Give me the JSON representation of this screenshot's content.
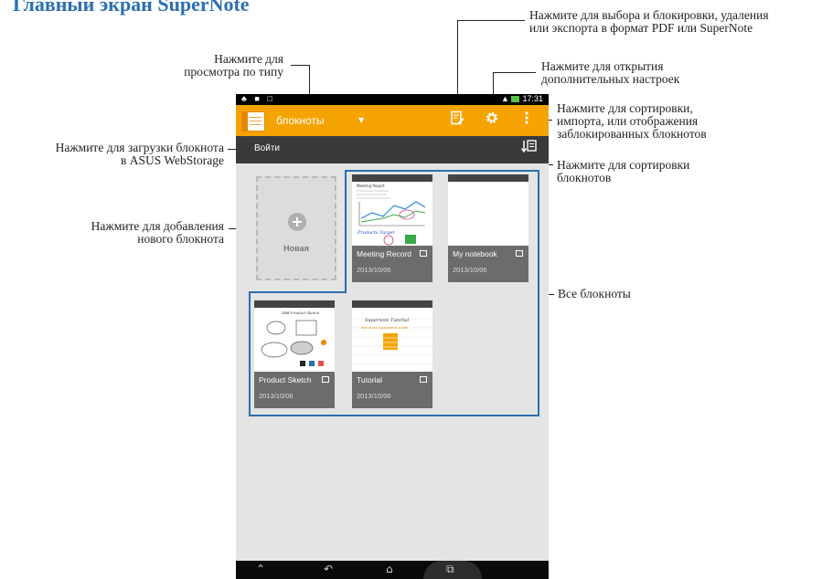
{
  "heading": "Главный экран SuperNote",
  "callouts": {
    "view_by_type": [
      "Нажмите для",
      "просмотра по типу"
    ],
    "select_lock_export": [
      "Нажмите для выбора и блокировки, удаления",
      "или экспорта в формат PDF или SuperNote"
    ],
    "settings": [
      "Нажмите для открытия",
      "дополнительных настроек"
    ],
    "sort_import_locked": [
      "Нажмите для сортировки,",
      "импорта, или отображения",
      "заблокированных блокнотов"
    ],
    "upload": [
      "Нажмите для загрузки блокнота",
      "в ASUS WebStorage"
    ],
    "sort_notebooks": [
      "Нажмите для сортировки",
      "блокнотов"
    ],
    "add_notebook": [
      "Нажмите для добавления",
      "нового блокнота"
    ],
    "all_notebooks": "Все блокноты"
  },
  "app": {
    "status_time": "17:31",
    "title": "блокноты",
    "signin": "Войти",
    "new_label": "Новая",
    "icons": {
      "edit": "edit-select-icon",
      "settings": "gear-icon",
      "overflow": "overflow-menu-icon",
      "sort": "sort-icon"
    },
    "colors": {
      "actionbar": "#f5a300",
      "signbar": "#3a3a3a",
      "callout_box": "#2a6fb0"
    },
    "notebooks": [
      {
        "name": "Meeting Record",
        "date": "2013/10/06",
        "thumb_title": "Meeting Report",
        "thumb_caption": "Products Target"
      },
      {
        "name": "My notebook",
        "date": "2013/10/06"
      },
      {
        "name": "Product Sketch",
        "date": "2013/10/06",
        "thumb_title": "ZBB Product Sketch"
      },
      {
        "name": "Tutorial",
        "date": "2013/10/06",
        "thumb_title": "Supernote Tutorial",
        "thumb_subtitle": "How to use Supernote as a note"
      }
    ]
  }
}
